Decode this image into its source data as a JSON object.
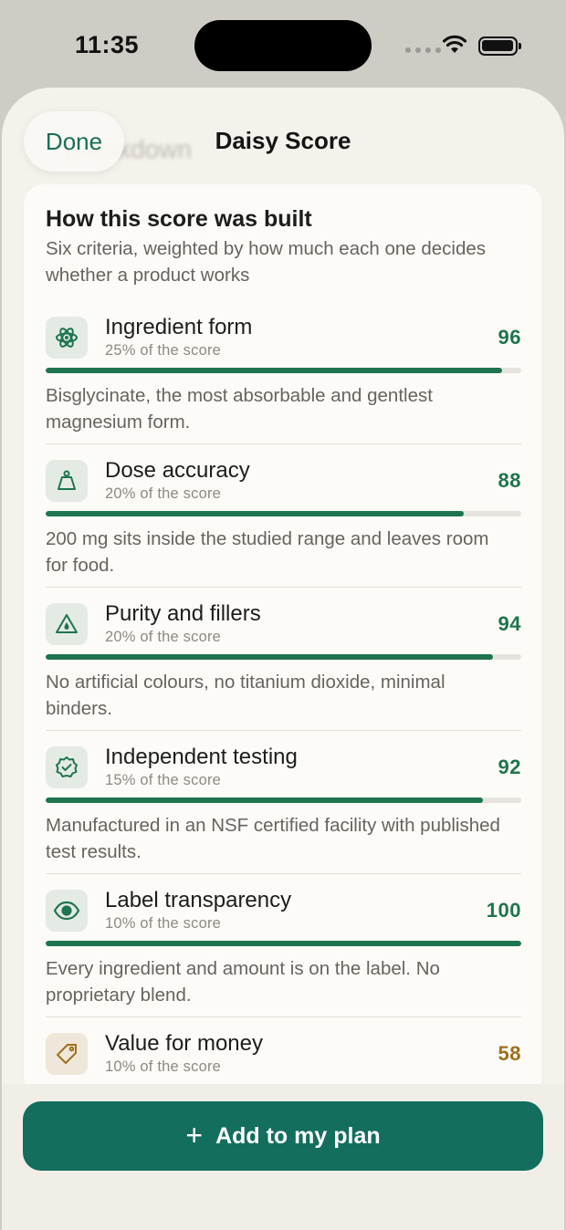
{
  "status": {
    "time": "11:35"
  },
  "nav": {
    "done_label": "Done",
    "title": "Daisy Score",
    "ghost_title": "Breakdown"
  },
  "card": {
    "title": "How this score was built",
    "subtitle": "Six criteria, weighted by how much each one decides whether a product works"
  },
  "criteria": [
    {
      "name": "Ingredient form",
      "weight": "25% of the score",
      "score": "96",
      "value": 0.96,
      "icon": "atom-icon",
      "description": "Bisglycinate, the most absorbable and gentlest magnesium form."
    },
    {
      "name": "Dose accuracy",
      "weight": "20% of the score",
      "score": "88",
      "value": 0.88,
      "icon": "weight-icon",
      "description": "200 mg sits inside the studied range and leaves room for food."
    },
    {
      "name": "Purity and fillers",
      "weight": "20% of the score",
      "score": "94",
      "value": 0.94,
      "icon": "drop-warning-icon",
      "description": "No artificial colours, no titanium dioxide, minimal binders."
    },
    {
      "name": "Independent testing",
      "weight": "15% of the score",
      "score": "92",
      "value": 0.92,
      "icon": "verified-badge-icon",
      "description": "Manufactured in an NSF certified facility with published test results."
    },
    {
      "name": "Label transparency",
      "weight": "10% of the score",
      "score": "100",
      "value": 1.0,
      "icon": "eye-icon",
      "description": "Every ingredient and amount is on the label. No proprietary blend."
    },
    {
      "name": "Value for money",
      "weight": "10% of the score",
      "score": "58",
      "value": 0.58,
      "icon": "price-tag-icon",
      "description": ""
    }
  ],
  "colors": {
    "accent": "#1f7450",
    "warning": "#a0701e",
    "button": "#136e5e"
  },
  "cta": {
    "label": "Add to my plan"
  }
}
